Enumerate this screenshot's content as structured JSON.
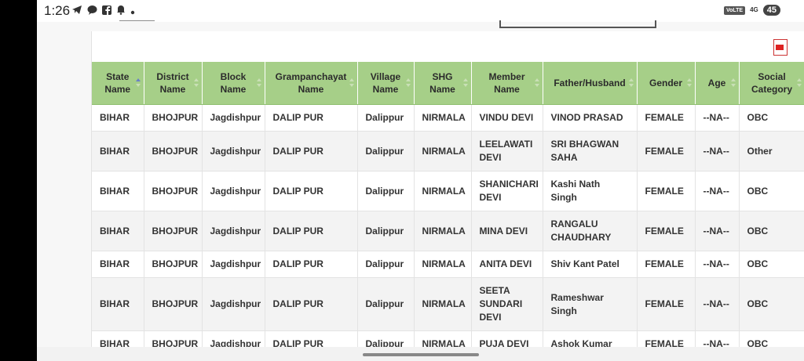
{
  "status_bar": {
    "time": "1:26",
    "icons": [
      "telegram-icon",
      "chat-icon",
      "facebook-icon",
      "notification-icon",
      "dot-icon"
    ],
    "volte": "VoLTE",
    "network": "4G",
    "battery": "45"
  },
  "table": {
    "headers": [
      "State Name",
      "District Name",
      "Block Name",
      "Grampanchayat Name",
      "Village Name",
      "SHG Name",
      "Member Name",
      "Father/Husband",
      "Gender",
      "Age",
      "Social Category"
    ],
    "rows": [
      [
        "BIHAR",
        "BHOJPUR",
        "Jagdishpur",
        "DALIP PUR",
        "Dalippur",
        "NIRMALA",
        "VINDU DEVI",
        "VINOD PRASAD",
        "FEMALE",
        "--NA--",
        "OBC"
      ],
      [
        "BIHAR",
        "BHOJPUR",
        "Jagdishpur",
        "DALIP PUR",
        "Dalippur",
        "NIRMALA",
        "LEELAWATI DEVI",
        "SRI BHAGWAN SAHA",
        "FEMALE",
        "--NA--",
        "Other"
      ],
      [
        "BIHAR",
        "BHOJPUR",
        "Jagdishpur",
        "DALIP PUR",
        "Dalippur",
        "NIRMALA",
        "SHANICHARI DEVI",
        "Kashi Nath Singh",
        "FEMALE",
        "--NA--",
        "OBC"
      ],
      [
        "BIHAR",
        "BHOJPUR",
        "Jagdishpur",
        "DALIP PUR",
        "Dalippur",
        "NIRMALA",
        "MINA DEVI",
        "RANGALU CHAUDHARY",
        "FEMALE",
        "--NA--",
        "OBC"
      ],
      [
        "BIHAR",
        "BHOJPUR",
        "Jagdishpur",
        "DALIP PUR",
        "Dalippur",
        "NIRMALA",
        "ANITA DEVI",
        "Shiv Kant Patel",
        "FEMALE",
        "--NA--",
        "OBC"
      ],
      [
        "BIHAR",
        "BHOJPUR",
        "Jagdishpur",
        "DALIP PUR",
        "Dalippur",
        "NIRMALA",
        "SEETA SUNDARI DEVI",
        "Rameshwar Singh",
        "FEMALE",
        "--NA--",
        "OBC"
      ],
      [
        "BIHAR",
        "BHOJPUR",
        "Jagdishpur",
        "DALIP PUR",
        "Dalippur",
        "NIRMALA",
        "PUJA DEVI",
        "Ashok Kumar",
        "FEMALE",
        "--NA--",
        "OBC"
      ]
    ]
  },
  "export": {
    "icon": "pdf-icon"
  }
}
